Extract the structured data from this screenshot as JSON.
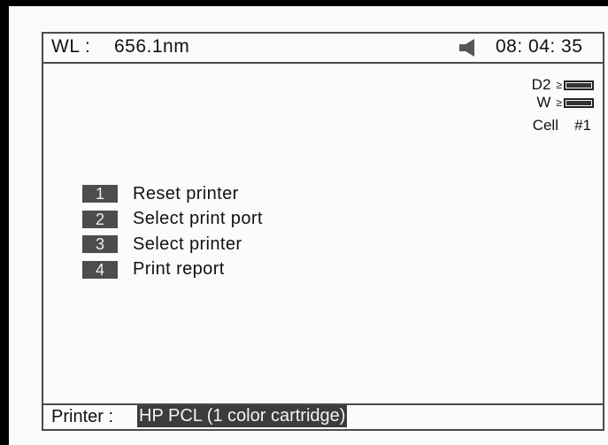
{
  "header": {
    "wl_label": "WL :",
    "wl_value": "656.1nm",
    "time": "08: 04: 35",
    "speaker_icon": "speaker-icon"
  },
  "status": {
    "lamps": [
      {
        "name": "D2",
        "symbol": "≥",
        "level": 1.0
      },
      {
        "name": "W",
        "symbol": "≥",
        "level": 1.0
      }
    ],
    "cell_label": "Cell",
    "cell_value": "#1"
  },
  "menu": {
    "items": [
      {
        "number": "1",
        "label": "Reset printer"
      },
      {
        "number": "2",
        "label": "Select print port"
      },
      {
        "number": "3",
        "label": "Select printer"
      },
      {
        "number": "4",
        "label": "Print report"
      }
    ]
  },
  "footer": {
    "printer_label": "Printer :",
    "printer_value": "HP PCL (1 color cartridge)"
  },
  "colors": {
    "background": "#fbfbfa",
    "border": "#4a4a4a",
    "highlight": "#3c3c3c",
    "menu_number_bg": "#4d4d4d"
  }
}
